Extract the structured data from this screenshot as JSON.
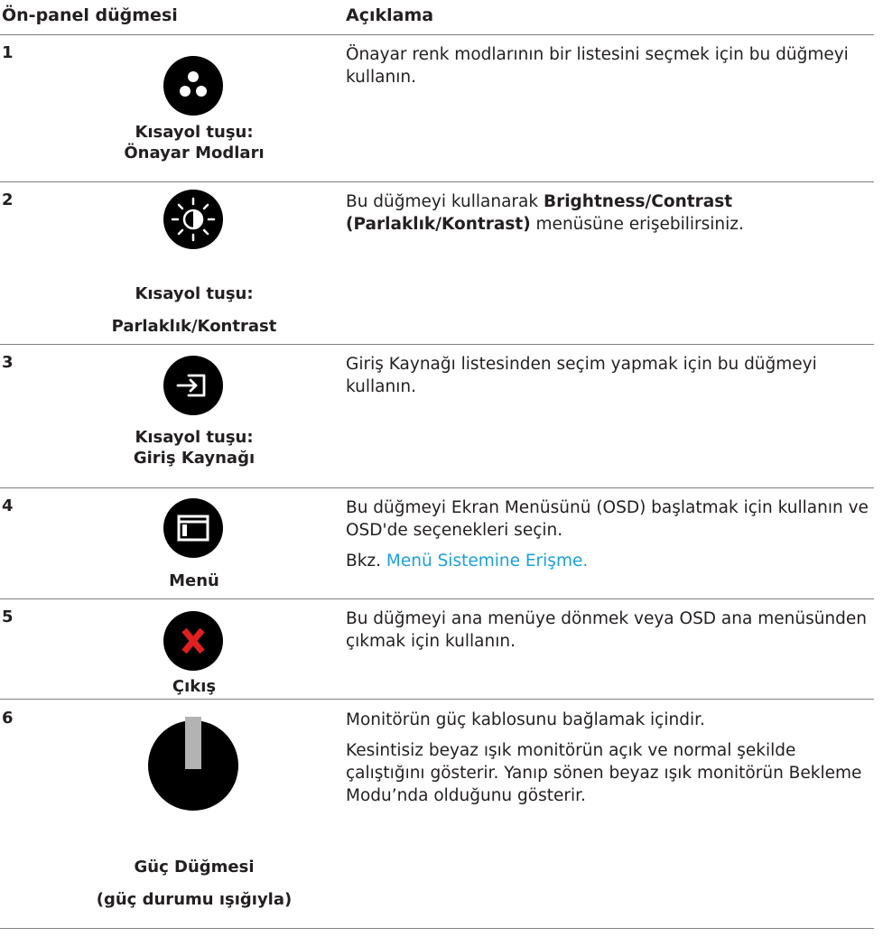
{
  "header": {
    "col_button": "Ön-panel düğmesi",
    "col_description": "Açıklama"
  },
  "rows": [
    {
      "number": "1",
      "icon": "preset-modes-icon",
      "label": [
        "Kısayol tuşu:",
        "Önayar Modları"
      ],
      "description": [
        "Önayar renk modlarının bir listesini seçmek için bu düğmeyi kullanın."
      ]
    },
    {
      "number": "2",
      "icon": "brightness-contrast-icon",
      "label": [
        "Kısayol tuşu:",
        "Parlaklık/Kontrast"
      ],
      "description_prefix": "Bu düğmeyi kullanarak ",
      "description_bold": "Brightness/Contrast (Parlaklık/Kontrast)",
      "description_suffix": " menüsüne erişebilirsiniz."
    },
    {
      "number": "3",
      "icon": "input-source-icon",
      "label": [
        "Kısayol tuşu:",
        "Giriş Kaynağı"
      ],
      "description": [
        "Giriş Kaynağı listesinden seçim yapmak için bu düğmeyi kullanın."
      ]
    },
    {
      "number": "4",
      "icon": "menu-icon",
      "label": [
        "Menü"
      ],
      "description": [
        "Bu düğmeyi Ekran Menüsünü (OSD) başlatmak için kullanın ve OSD'de seçenekleri seçin."
      ],
      "see_prefix": "Bkz. ",
      "see_link": "Menü Sistemine Erişme."
    },
    {
      "number": "5",
      "icon": "exit-icon",
      "label": [
        "Çıkış"
      ],
      "description": [
        "Bu düğmeyi ana menüye dönmek veya OSD ana menüsünden çıkmak için kullanın."
      ]
    },
    {
      "number": "6",
      "icon": "power-button-icon",
      "label": [
        "Güç Düğmesi",
        "(güç durumu ışığıyla)"
      ],
      "description": [
        "Monitörün güç kablosunu bağlamak içindir.",
        "Kesintisiz beyaz ışık monitörün açık ve normal şekilde çalıştığını gösterir. Yanıp sönen beyaz ışık monitörün Bekleme Modu’nda olduğunu gösterir."
      ]
    }
  ],
  "colors": {
    "text": "#231f20",
    "icon_fill": "#000000",
    "exit_x": "#e02020",
    "power_light": "#b3b3b3",
    "link": "#1ba1dd",
    "rule": "#7f7f7f"
  }
}
